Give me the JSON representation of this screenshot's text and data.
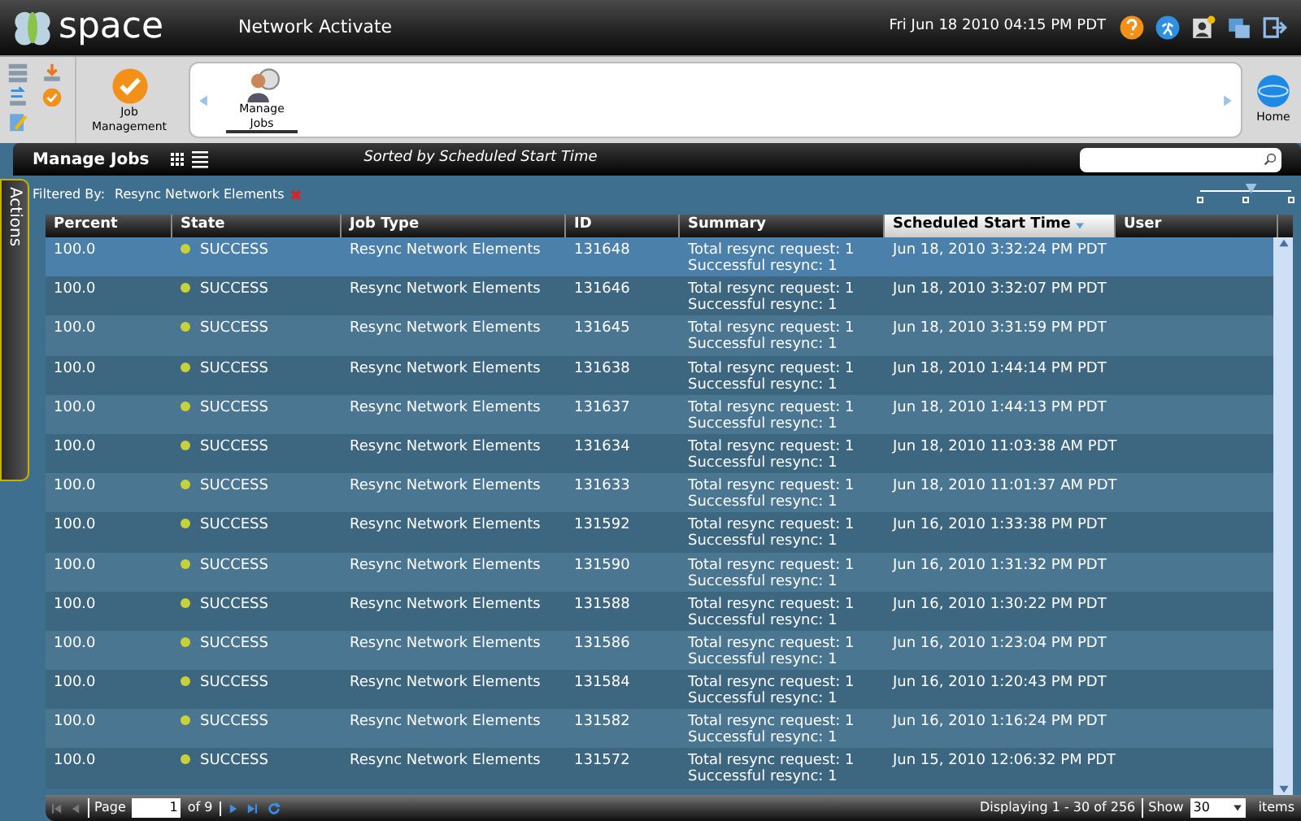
{
  "header": {
    "brand": "space",
    "app_title": "Network Activate",
    "datetime": "Fri Jun 18 2010 04:15 PM PDT"
  },
  "toolbar": {
    "current": {
      "label": "Job Management"
    },
    "items": [
      {
        "label": "Manage Jobs",
        "selected": true
      }
    ],
    "home": "Home"
  },
  "panel": {
    "title": "Manage Jobs",
    "sort_note": "Sorted by Scheduled Start Time",
    "filter_label": "Filtered By:",
    "filter_value": "Resync Network Elements",
    "zoom": {
      "level": 0.55
    }
  },
  "side_tab": "Actions",
  "table": {
    "columns": [
      {
        "label": "Percent",
        "sorted": false
      },
      {
        "label": "State",
        "sorted": false
      },
      {
        "label": "Job Type",
        "sorted": false
      },
      {
        "label": "ID",
        "sorted": false
      },
      {
        "label": "Summary",
        "sorted": false
      },
      {
        "label": "Scheduled Start Time",
        "sorted": true
      },
      {
        "label": "User",
        "sorted": false
      }
    ],
    "rows": [
      {
        "selected": true,
        "percent": "100.0",
        "state": "SUCCESS",
        "job_type": "Resync Network Elements",
        "id": "131648",
        "summary": [
          "Total resync request: 1",
          "Successful resync: 1"
        ],
        "start": "Jun 18, 2010 3:32:24 PM PDT"
      },
      {
        "selected": false,
        "percent": "100.0",
        "state": "SUCCESS",
        "job_type": "Resync Network Elements",
        "id": "131646",
        "summary": [
          "Total resync request: 1",
          "Successful resync: 1"
        ],
        "start": "Jun 18, 2010 3:32:07 PM PDT"
      },
      {
        "selected": false,
        "percent": "100.0",
        "state": "SUCCESS",
        "job_type": "Resync Network Elements",
        "id": "131645",
        "summary": [
          "Total resync request: 1",
          "Successful resync: 1"
        ],
        "start": "Jun 18, 2010 3:31:59 PM PDT"
      },
      {
        "selected": false,
        "percent": "100.0",
        "state": "SUCCESS",
        "job_type": "Resync Network Elements",
        "id": "131638",
        "summary": [
          "Total resync request: 1",
          "Successful resync: 1"
        ],
        "start": "Jun 18, 2010 1:44:14 PM PDT"
      },
      {
        "selected": false,
        "percent": "100.0",
        "state": "SUCCESS",
        "job_type": "Resync Network Elements",
        "id": "131637",
        "summary": [
          "Total resync request: 1",
          "Successful resync: 1"
        ],
        "start": "Jun 18, 2010 1:44:13 PM PDT"
      },
      {
        "selected": false,
        "percent": "100.0",
        "state": "SUCCESS",
        "job_type": "Resync Network Elements",
        "id": "131634",
        "summary": [
          "Total resync request: 1",
          "Successful resync: 1"
        ],
        "start": "Jun 18, 2010 11:03:38 AM PDT"
      },
      {
        "selected": false,
        "percent": "100.0",
        "state": "SUCCESS",
        "job_type": "Resync Network Elements",
        "id": "131633",
        "summary": [
          "Total resync request: 1",
          "Successful resync: 1"
        ],
        "start": "Jun 18, 2010 11:01:37 AM PDT"
      },
      {
        "selected": false,
        "percent": "100.0",
        "state": "SUCCESS",
        "job_type": "Resync Network Elements",
        "id": "131592",
        "summary": [
          "Total resync request: 1",
          "Successful resync: 1"
        ],
        "start": "Jun 16, 2010 1:33:38 PM PDT"
      },
      {
        "selected": false,
        "percent": "100.0",
        "state": "SUCCESS",
        "job_type": "Resync Network Elements",
        "id": "131590",
        "summary": [
          "Total resync request: 1",
          "Successful resync: 1"
        ],
        "start": "Jun 16, 2010 1:31:32 PM PDT"
      },
      {
        "selected": false,
        "percent": "100.0",
        "state": "SUCCESS",
        "job_type": "Resync Network Elements",
        "id": "131588",
        "summary": [
          "Total resync request: 1",
          "Successful resync: 1"
        ],
        "start": "Jun 16, 2010 1:30:22 PM PDT"
      },
      {
        "selected": false,
        "percent": "100.0",
        "state": "SUCCESS",
        "job_type": "Resync Network Elements",
        "id": "131586",
        "summary": [
          "Total resync request: 1",
          "Successful resync: 1"
        ],
        "start": "Jun 16, 2010 1:23:04 PM PDT"
      },
      {
        "selected": false,
        "percent": "100.0",
        "state": "SUCCESS",
        "job_type": "Resync Network Elements",
        "id": "131584",
        "summary": [
          "Total resync request: 1",
          "Successful resync: 1"
        ],
        "start": "Jun 16, 2010 1:20:43 PM PDT"
      },
      {
        "selected": false,
        "percent": "100.0",
        "state": "SUCCESS",
        "job_type": "Resync Network Elements",
        "id": "131582",
        "summary": [
          "Total resync request: 1",
          "Successful resync: 1"
        ],
        "start": "Jun 16, 2010 1:16:24 PM PDT"
      },
      {
        "selected": false,
        "percent": "100.0",
        "state": "SUCCESS",
        "job_type": "Resync Network Elements",
        "id": "131572",
        "summary": [
          "Total resync request: 1",
          "Successful resync: 1"
        ],
        "start": "Jun 15, 2010 12:06:32 PM PDT"
      }
    ]
  },
  "pager": {
    "page_label": "Page",
    "page": "1",
    "of": "of 9",
    "displaying": "Displaying 1 - 30 of 256",
    "show_label": "Show",
    "show_value": "30",
    "items_label": "items"
  }
}
